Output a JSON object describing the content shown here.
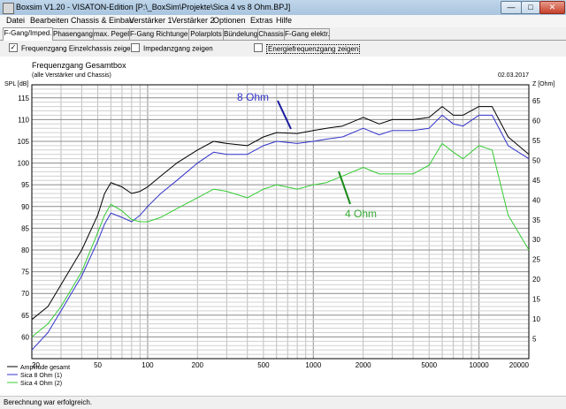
{
  "window": {
    "title": "Boxsim V1.20 - VISATON-Edition [P:\\_BoxSim\\Projekte\\Sica 4 vs 8 Ohm.BPJ]",
    "minimize_label": "—",
    "maximize_label": "□",
    "close_label": "✕"
  },
  "menu": [
    "Datei",
    "Bearbeiten",
    "Chassis & Einbau",
    "Verstärker 1",
    "Verstärker 2",
    "Optionen",
    "Extras",
    "Hilfe"
  ],
  "tabs": [
    "F-Gang/Imped.",
    "Phasengang",
    "max. Pegel",
    "F-Gang Richtungen",
    "Polarplots",
    "Bündelung",
    "Chassis",
    "F-Gang elektr."
  ],
  "active_tab": "F-Gang/Imped.",
  "options": [
    {
      "label": "Frequenzgang Einzelchassis zeigen",
      "checked": true
    },
    {
      "label": "Impedanzgang zeigen",
      "checked": false
    },
    {
      "label": "Energiefrequenzgang zeigen",
      "checked": false
    }
  ],
  "status": "Berechnung war erfolgreich.",
  "chart_data": {
    "type": "line",
    "title": "Frequenzgang Gesamtbox",
    "subtitle": "(alle Verstärker und Chassis)",
    "date": "02.03.2017",
    "ylabel": "SPL [dB]",
    "y2label": "Z [Ohm]",
    "xscale": "log",
    "xlim": [
      20,
      20000
    ],
    "ylim": [
      55,
      118
    ],
    "y2lim": [
      0,
      69
    ],
    "grid": true,
    "x_ticks": [
      20,
      50,
      100,
      200,
      500,
      1000,
      2000,
      5000,
      10000,
      20000
    ],
    "x_tick_labels": [
      "20",
      "50",
      "100",
      "200",
      "500",
      "1000",
      "2000",
      "5000",
      "10000",
      "20000"
    ],
    "y_ticks": [
      60,
      65,
      70,
      75,
      80,
      85,
      90,
      95,
      100,
      105,
      110,
      115
    ],
    "y2_ticks": [
      5,
      10,
      15,
      20,
      25,
      30,
      35,
      40,
      45,
      50,
      55,
      60,
      65
    ],
    "series": [
      {
        "name": "Amplitude gesamt",
        "color": "#000000",
        "x": [
          20,
          25,
          30,
          40,
          50,
          55,
          60,
          70,
          80,
          90,
          100,
          120,
          150,
          200,
          250,
          300,
          400,
          500,
          600,
          800,
          1000,
          1200,
          1500,
          2000,
          2500,
          3000,
          4000,
          5000,
          6000,
          7000,
          8000,
          10000,
          12000,
          15000,
          20000
        ],
        "y": [
          64,
          67,
          72,
          80,
          88,
          93,
          95.5,
          94.5,
          93,
          93.5,
          94.5,
          97,
          100,
          103,
          105,
          104.5,
          104,
          106,
          107,
          106.8,
          107.5,
          108,
          108.5,
          110.5,
          109,
          110,
          110,
          110.5,
          113,
          111,
          111,
          113,
          113,
          106,
          102
        ]
      },
      {
        "name": "Sica 8 Ohm (1)",
        "color": "#3333cc",
        "x": [
          20,
          25,
          30,
          40,
          50,
          55,
          60,
          70,
          80,
          90,
          100,
          120,
          150,
          200,
          250,
          300,
          400,
          500,
          600,
          800,
          1000,
          1200,
          1500,
          2000,
          2500,
          3000,
          4000,
          5000,
          6000,
          7000,
          8000,
          10000,
          12000,
          15000,
          20000
        ],
        "y": [
          57,
          61,
          66,
          74,
          82,
          86,
          88.5,
          87.5,
          86.5,
          88,
          90,
          93,
          96,
          100,
          102.5,
          102,
          102,
          104,
          105,
          104.5,
          105,
          105.5,
          106,
          108,
          106.5,
          107.5,
          107.5,
          108,
          111,
          109,
          108.5,
          111,
          111,
          104,
          101
        ]
      },
      {
        "name": "Sica 4 Ohm (2)",
        "color": "#33cc33",
        "x": [
          20,
          25,
          30,
          40,
          50,
          55,
          60,
          70,
          80,
          90,
          100,
          120,
          150,
          200,
          250,
          300,
          400,
          500,
          600,
          800,
          1000,
          1200,
          1500,
          2000,
          2500,
          3000,
          4000,
          5000,
          6000,
          7000,
          8000,
          10000,
          12000,
          15000,
          20000
        ],
        "y": [
          60,
          63,
          67,
          75,
          84,
          88,
          90.5,
          89,
          87,
          86.5,
          86.5,
          87.5,
          89.5,
          92,
          94,
          93.5,
          92,
          94,
          95,
          94,
          95,
          95.5,
          97,
          99,
          97.5,
          97.5,
          97.5,
          99.5,
          104.5,
          102.5,
          101,
          104,
          103,
          88,
          80
        ]
      }
    ],
    "annotations": [
      {
        "text": "8 Ohm",
        "color": "#3333cc"
      },
      {
        "text": "4 Ohm",
        "color": "#33aa33"
      }
    ]
  }
}
